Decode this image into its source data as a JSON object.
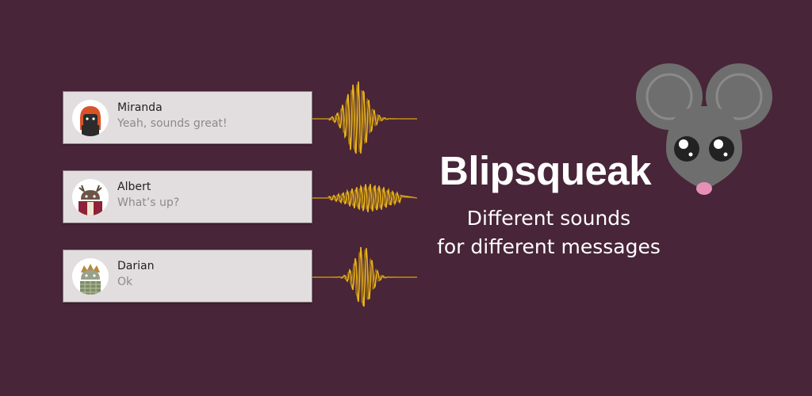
{
  "app": {
    "title": "Blipsqueak",
    "tagline_line1": "Different sounds",
    "tagline_line2": "for different messages"
  },
  "notifications": [
    {
      "name": "Miranda",
      "message": "Yeah, sounds great!",
      "avatar_icon": "robot-avatar-red-hair-icon"
    },
    {
      "name": "Albert",
      "message": "What’s up?",
      "avatar_icon": "robot-avatar-antlers-icon"
    },
    {
      "name": "Darian",
      "message": "Ok",
      "avatar_icon": "robot-avatar-spiky-hair-icon"
    }
  ],
  "colors": {
    "background": "#482538",
    "card": "#e2dedf",
    "wave": "#e9b21e",
    "mouse_gray": "#6e6e6e",
    "nose_pink": "#e88fb9"
  },
  "icons": [
    "sound-wave-icon",
    "mouse-mascot-icon"
  ]
}
